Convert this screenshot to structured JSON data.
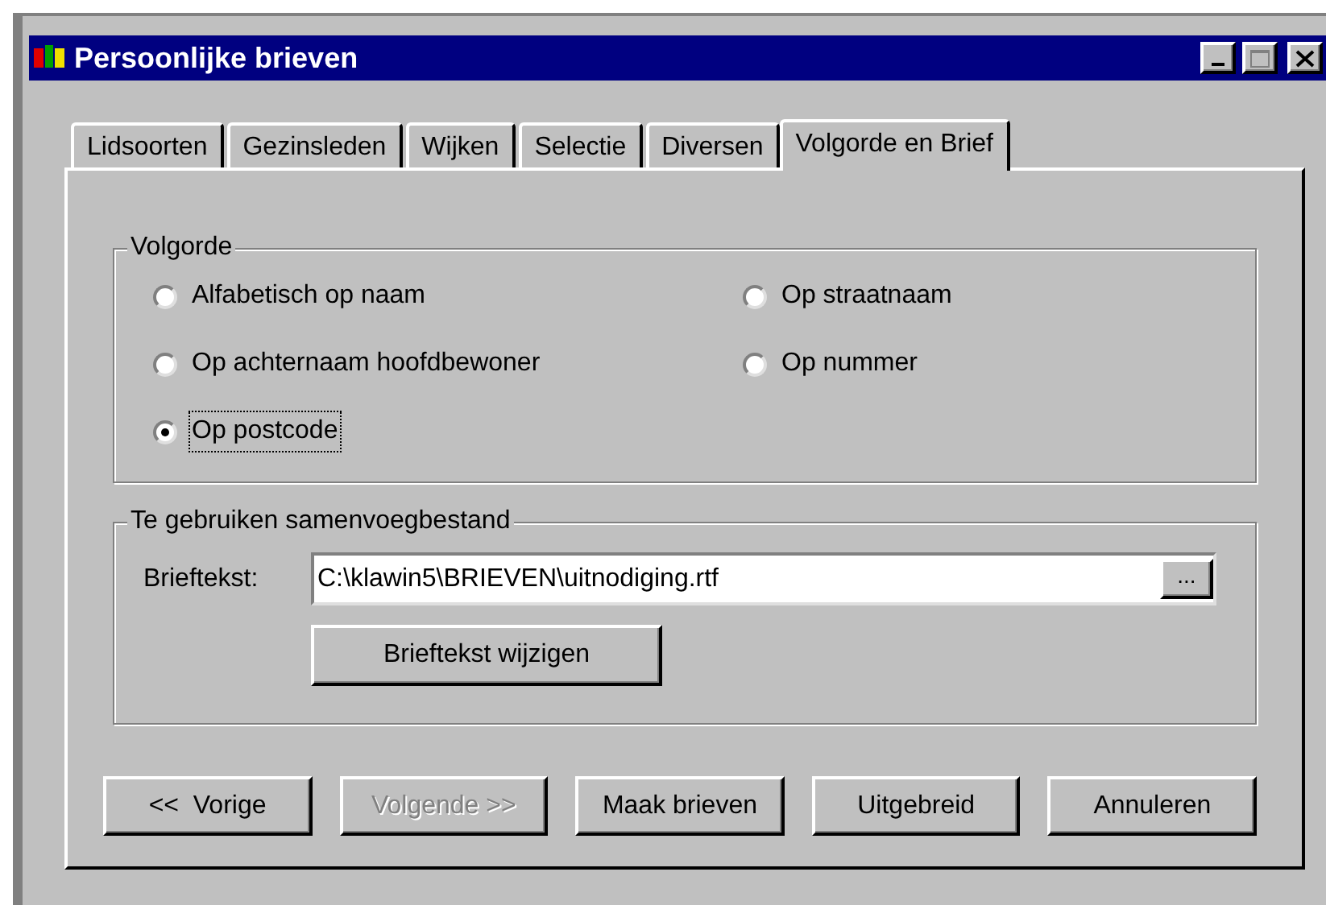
{
  "window": {
    "title": "Persoonlijke brieven"
  },
  "tabs": [
    {
      "label": "Lidsoorten",
      "selected": false
    },
    {
      "label": "Gezinsleden",
      "selected": false
    },
    {
      "label": "Wijken",
      "selected": false
    },
    {
      "label": "Selectie",
      "selected": false
    },
    {
      "label": "Diversen",
      "selected": false
    },
    {
      "label": "Volgorde en Brief",
      "selected": true
    }
  ],
  "order_group": {
    "title": "Volgorde",
    "options": [
      {
        "label": "Alfabetisch op naam",
        "selected": false,
        "focused": false
      },
      {
        "label": "Op straatnaam",
        "selected": false,
        "focused": false
      },
      {
        "label": "Op achternaam hoofdbewoner",
        "selected": false,
        "focused": false
      },
      {
        "label": "Op nummer",
        "selected": false,
        "focused": false
      },
      {
        "label": "Op postcode",
        "selected": true,
        "focused": true
      }
    ]
  },
  "merge_group": {
    "title": "Te gebruiken samenvoegbestand",
    "field_label": "Brieftekst:",
    "field_value": "C:\\klawin5\\BRIEVEN\\uitnodiging.rtf",
    "browse_label": "...",
    "change_button": "Brieftekst wijzigen"
  },
  "buttons": [
    {
      "label": "<<  Vorige",
      "disabled": false
    },
    {
      "label": "Volgende >>",
      "disabled": true
    },
    {
      "label": "Maak brieven",
      "disabled": false
    },
    {
      "label": "Uitgebreid",
      "disabled": false
    },
    {
      "label": "Annuleren",
      "disabled": false
    }
  ]
}
